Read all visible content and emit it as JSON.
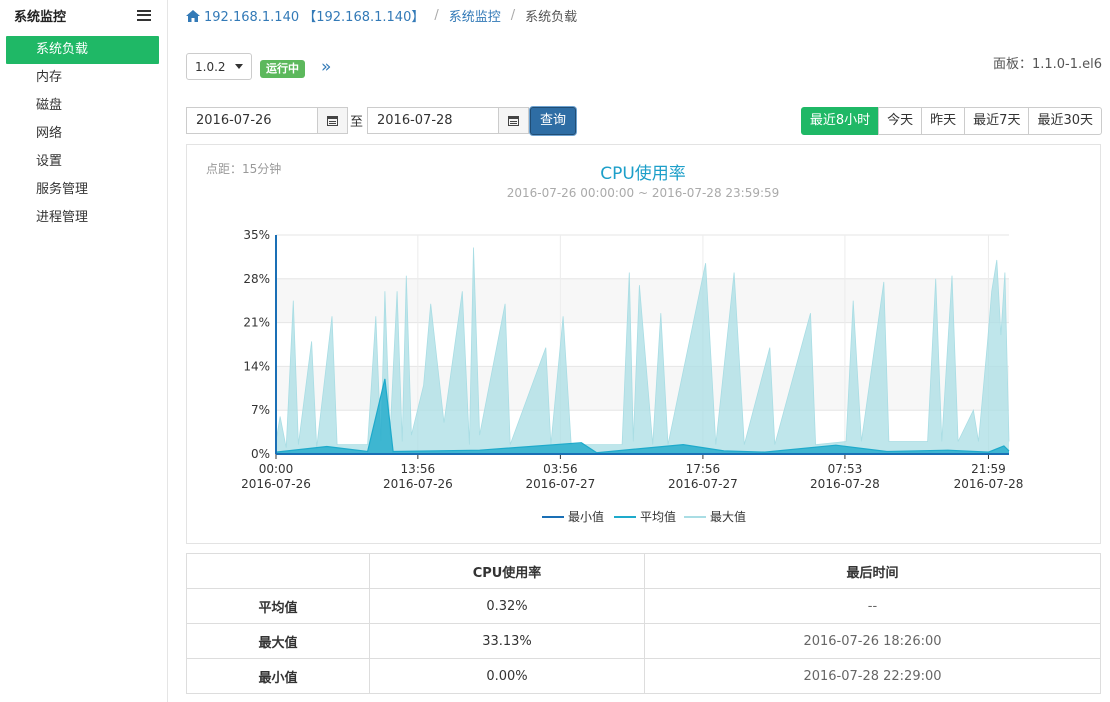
{
  "sidebar": {
    "title": "系统监控",
    "items": [
      {
        "label": "系统负载",
        "active": true
      },
      {
        "label": "内存",
        "active": false
      },
      {
        "label": "磁盘",
        "active": false
      },
      {
        "label": "网络",
        "active": false
      },
      {
        "label": "设置",
        "active": false
      },
      {
        "label": "服务管理",
        "active": false
      },
      {
        "label": "进程管理",
        "active": false
      }
    ]
  },
  "breadcrumb": {
    "host": "192.168.1.140 【192.168.1.140】",
    "section": "系统监控",
    "page": "系统负载"
  },
  "toolbar": {
    "version": "1.0.2",
    "status": "运行中",
    "panel_version": "面板：1.1.0-1.el6"
  },
  "filter": {
    "start_date": "2016-07-26",
    "end_date": "2016-07-28",
    "to_label": "至",
    "query_label": "查询",
    "ranges": [
      {
        "label": "最近8小时",
        "active": true
      },
      {
        "label": "今天",
        "active": false
      },
      {
        "label": "昨天",
        "active": false
      },
      {
        "label": "最近7天",
        "active": false
      },
      {
        "label": "最近30天",
        "active": false
      }
    ]
  },
  "chart_data": {
    "type": "area",
    "title": "CPU使用率",
    "subtitle": "2016-07-26 00:00:00 ~ 2016-07-28 23:59:59",
    "interval_note": "点距：15分钟",
    "y_ticks": [
      "0%",
      "7%",
      "14%",
      "21%",
      "28%",
      "35%"
    ],
    "ylim": [
      0,
      35
    ],
    "x_ticks": [
      {
        "time": "00:00",
        "date": "2016-07-26"
      },
      {
        "time": "13:56",
        "date": "2016-07-26"
      },
      {
        "time": "03:56",
        "date": "2016-07-27"
      },
      {
        "time": "17:56",
        "date": "2016-07-27"
      },
      {
        "time": "07:53",
        "date": "2016-07-28"
      },
      {
        "time": "21:59",
        "date": "2016-07-28"
      }
    ],
    "grid": true,
    "legend_position": "bottom",
    "series": [
      {
        "name": "最小值",
        "color": "#1a6fb5",
        "values": [
          [
            0,
            0
          ],
          [
            10,
            0
          ],
          [
            20,
            0
          ],
          [
            30,
            0
          ],
          [
            40,
            0
          ],
          [
            50,
            0
          ],
          [
            60,
            0
          ],
          [
            72,
            0
          ]
        ]
      },
      {
        "name": "平均值",
        "color": "#1eaacb",
        "values": [
          [
            0,
            0.3
          ],
          [
            5,
            1.2
          ],
          [
            9,
            0.4
          ],
          [
            10.7,
            12
          ],
          [
            11.5,
            0.4
          ],
          [
            20,
            0.6
          ],
          [
            30,
            1.8
          ],
          [
            31.5,
            0.2
          ],
          [
            40,
            1.5
          ],
          [
            44,
            0.5
          ],
          [
            48,
            0.3
          ],
          [
            55,
            1.4
          ],
          [
            60,
            0.4
          ],
          [
            66,
            0.6
          ],
          [
            70,
            0.3
          ],
          [
            71.5,
            1.3
          ],
          [
            72,
            0.5
          ]
        ]
      },
      {
        "name": "最大值",
        "color": "#a9dde4",
        "values": [
          [
            0,
            2
          ],
          [
            0.4,
            6
          ],
          [
            1,
            1
          ],
          [
            1.7,
            24.5
          ],
          [
            2.2,
            1.5
          ],
          [
            3.5,
            18
          ],
          [
            4,
            1
          ],
          [
            5.5,
            22
          ],
          [
            6,
            1.5
          ],
          [
            9,
            1.5
          ],
          [
            9.8,
            22
          ],
          [
            10.3,
            2
          ],
          [
            10.7,
            26
          ],
          [
            11.2,
            3
          ],
          [
            11.9,
            26
          ],
          [
            12.4,
            2
          ],
          [
            12.8,
            28.5
          ],
          [
            13.3,
            3
          ],
          [
            14.5,
            11
          ],
          [
            15.2,
            24
          ],
          [
            16.5,
            5
          ],
          [
            18.3,
            26
          ],
          [
            19,
            1.5
          ],
          [
            19.4,
            33
          ],
          [
            20,
            3
          ],
          [
            22.5,
            24
          ],
          [
            23,
            1.5
          ],
          [
            26.5,
            17
          ],
          [
            27,
            1.5
          ],
          [
            28.2,
            22
          ],
          [
            29,
            1.5
          ],
          [
            34,
            1.5
          ],
          [
            34.7,
            29
          ],
          [
            35.1,
            2
          ],
          [
            35.7,
            27
          ],
          [
            37,
            1.5
          ],
          [
            37.8,
            22.5
          ],
          [
            38.5,
            1.5
          ],
          [
            42.2,
            30.5
          ],
          [
            43.2,
            1.5
          ],
          [
            45,
            29
          ],
          [
            46,
            1.5
          ],
          [
            48.5,
            17
          ],
          [
            49,
            1.5
          ],
          [
            52.5,
            22.5
          ],
          [
            53,
            1.5
          ],
          [
            56,
            2
          ],
          [
            56.7,
            24.5
          ],
          [
            57.5,
            2
          ],
          [
            59.7,
            27.5
          ],
          [
            60.2,
            2
          ],
          [
            64,
            2
          ],
          [
            64.8,
            28
          ],
          [
            65.4,
            2
          ],
          [
            66.4,
            28.5
          ],
          [
            67,
            2
          ],
          [
            68.5,
            7
          ],
          [
            69,
            2
          ],
          [
            69.9,
            18
          ],
          [
            70.3,
            26
          ],
          [
            70.8,
            31
          ],
          [
            71.2,
            19
          ],
          [
            71.6,
            29
          ],
          [
            72,
            2
          ]
        ]
      }
    ],
    "table": {
      "headers": [
        "",
        "CPU使用率",
        "最后时间"
      ],
      "rows": [
        {
          "label": "平均值",
          "value": "0.32%",
          "time": "--"
        },
        {
          "label": "最大值",
          "value": "33.13%",
          "time": "2016-07-26 18:26:00"
        },
        {
          "label": "最小值",
          "value": "0.00%",
          "time": "2016-07-28 22:29:00"
        }
      ]
    }
  }
}
